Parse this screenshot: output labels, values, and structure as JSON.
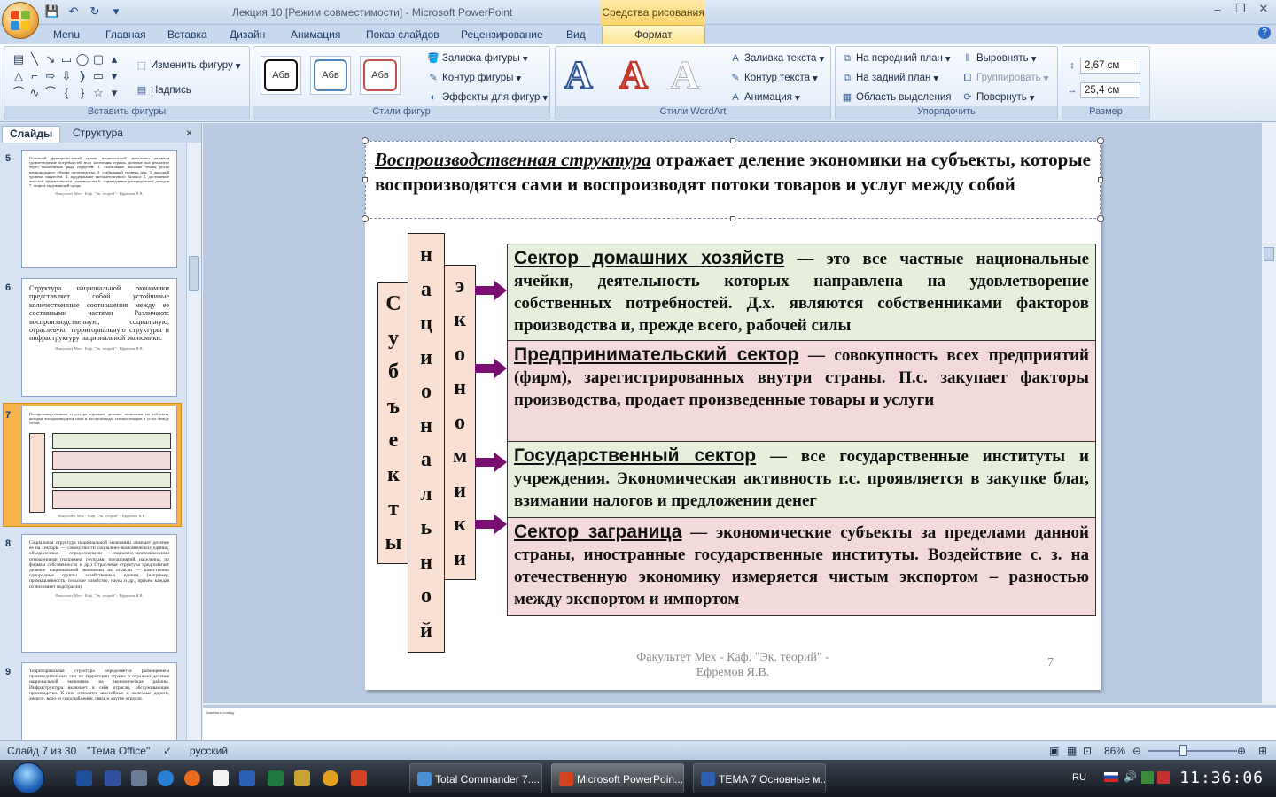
{
  "window": {
    "title": "Лекция 10 [Режим совместимости] - Microsoft PowerPoint",
    "context_tab_title": "Средства рисования"
  },
  "tabs": [
    "Menu",
    "Главная",
    "Вставка",
    "Дизайн",
    "Анимация",
    "Показ слайдов",
    "Рецензирование",
    "Вид",
    "Формат"
  ],
  "ribbon": {
    "insert_shapes": {
      "label": "Вставить фигуры",
      "change_shape": "Изменить фигуру",
      "text_box": "Надпись"
    },
    "shape_styles": {
      "label": "Стили фигур",
      "style_text": "Абв",
      "fill": "Заливка фигуры",
      "outline": "Контур фигуры",
      "effects": "Эффекты для фигур"
    },
    "wordart": {
      "label": "Стили WordArt",
      "letter": "A",
      "text_fill": "Заливка текста",
      "text_outline": "Контур текста",
      "animation": "Анимация"
    },
    "arrange": {
      "label": "Упорядочить",
      "front": "На передний план",
      "back": "На задний план",
      "selection": "Область выделения",
      "align": "Выровнять",
      "group": "Группировать",
      "rotate": "Повернуть"
    },
    "size": {
      "label": "Размер",
      "height": "2,67 см",
      "width": "25,4 см"
    }
  },
  "left_pane": {
    "tab_slides": "Слайды",
    "tab_outline": "Структура",
    "close": "×",
    "thumbnails": [
      {
        "number": "5",
        "text": "Основной функциональный целью национальной экономики является удовлетворение потребностей всех населения страны, которые она реализует через выполнение ряда подцелей: 1. стабильные высокие темпы роста национального объема производства. 2. стабильный уровень цен. 3. высокий уровень занятости. 4. поддержание внешнеторгового баланса 5. достижение высокой эффективности производства 6. справедливое распределение доходов 7. защита окружающей среды",
        "footer": "Факультет Мех - Каф. \"Эк. теорий\" - Ефремов Я.В."
      },
      {
        "number": "6",
        "text": "Структура национальной экономики представляет собой устойчивые количественные соотношения между ее составными частями Различают: воспроизводственную, социальную, отраслевую, территориальную структуры и инфраструктуру национальной экономики.",
        "footer": "Факультет Мех - Каф. \"Эк. теорий\" - Ефремов Я.В."
      },
      {
        "number": "7",
        "text": "Воспроизводственная структура отражает деление экономики на субъекты, которые воспроизводятся сами и воспроизводят потоки товаров и услуг между собой",
        "footer": "Факультет Мех - Каф. \"Эк. теорий\" - Ефремов Я.В."
      },
      {
        "number": "8",
        "text": "Социальная структура национальной экономики означает деление ее на секторы — совокупности социально-экономических единиц, объединенных определенными социально-экономическими отношениями (например, группами предприятий, населения, по формам собственности и др.) Отраслевая структура предполагает деление национальной экономики на отрасли — качественно однородные группы хозяйственных единиц (например, промышленность, сельское хозяйство, наука и др., причем каждая из них имеет подотрасли)",
        "footer": "Факультет Мех - Каф. \"Эк. теорий\" - Ефремов Я.В."
      },
      {
        "number": "9",
        "text": "Территориальная структура определяется размещением производительных сил по территории страны и отражает деление национальной экономики на экономические районы. Инфраструктура включает в себя отрасли, обслуживающие производство. К ним относятся шоссейные и железные дороги, энерго-, водо- и газоснабжение, связь и другие отрасли.",
        "footer": ""
      }
    ]
  },
  "slide": {
    "title_term": "Воспроизводственная структура",
    "title_rest": " отражает деление экономики на субъекты, которые воспроизводятся сами и  воспроизводят потоки товаров и услуг между собой",
    "vertical_words": {
      "subjects": [
        "С",
        "у",
        "б",
        "ъ",
        "е",
        "к",
        "т",
        "ы"
      ],
      "national": [
        "н",
        "а",
        "ц",
        "и",
        "о",
        "н",
        "а",
        "л",
        "ь",
        "н",
        "о",
        "й"
      ],
      "economy": [
        "э",
        "к",
        "о",
        "н",
        "о",
        "м",
        "и",
        "к",
        "и"
      ]
    },
    "sectors": [
      {
        "name": "Сектор домашних хозяйств",
        "text": " — это все частные национальные ячейки, деятельность которых направлена на удовлетворение собственных потребностей. Д.х. являются собственниками факторов производства и, прежде всего, рабочей силы",
        "bg": "#e6efdb"
      },
      {
        "name": "Предпринимательский сектор",
        "text": " — совокупность всех предприятий (фирм), зарегистрированных внутри страны. П.с. закупает факторы производства, продает произведенные товары и услуги",
        "bg": "#f3d9d9"
      },
      {
        "name": "Государственный сектор",
        "text": " — все государственные институты и учреждения. Экономическая активность г.с. проявляется в закупке благ, взимании налогов и предложении денег",
        "bg": "#e6efdb"
      },
      {
        "name": "Сектор заграница",
        "text": " — экономические субъекты за пределами данной страны, иностранные государственные институты. Воздействие с. з. на отечественную экономику измеряется чистым экспортом – разностью между экспортом и импортом",
        "bg": "#f3d9d9"
      }
    ],
    "footer": "Факультет Мех - Каф. \"Эк. теорий\" - Ефремов Я.В.",
    "page_number": "7",
    "arrow_color": "#7a0f72"
  },
  "notes": {
    "text": "Заметки к слайду"
  },
  "status": {
    "slide_counter": "Слайд 7 из 30",
    "theme": "\"Тема Office\"",
    "language": "русский",
    "zoom": "86%"
  },
  "taskbar": {
    "tasks": [
      "Total Commander 7....",
      "Microsoft PowerPoin...",
      "TEMA 7 Основные м..."
    ],
    "lang": "RU",
    "clock": "11:36:06"
  }
}
